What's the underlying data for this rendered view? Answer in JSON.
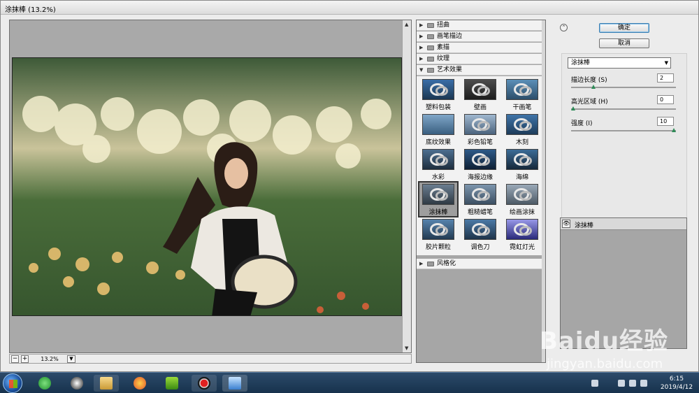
{
  "window": {
    "title": "涂抹棒 (13.2%)"
  },
  "preview": {
    "zoom": "13.2%",
    "zoom_minus": "−",
    "zoom_plus": "+"
  },
  "gallery": {
    "categories_top": [
      "扭曲",
      "画笔描边",
      "素描",
      "纹理",
      "艺术效果"
    ],
    "category_bottom": "风格化",
    "thumbnails": [
      {
        "label": "塑料包装"
      },
      {
        "label": "壁画"
      },
      {
        "label": "干画笔"
      },
      {
        "label": "底纹效果"
      },
      {
        "label": "彩色铅笔"
      },
      {
        "label": "木刻"
      },
      {
        "label": "水彩"
      },
      {
        "label": "海报边缘"
      },
      {
        "label": "海绵"
      },
      {
        "label": "涂抹棒"
      },
      {
        "label": "粗糙蜡笔"
      },
      {
        "label": "绘画涂抹"
      },
      {
        "label": "胶片颗粒"
      },
      {
        "label": "调色刀"
      },
      {
        "label": "霓虹灯光"
      }
    ],
    "selected": "涂抹棒"
  },
  "buttons": {
    "ok": "确定",
    "cancel": "取消"
  },
  "filter_select": {
    "value": "涂抹棒"
  },
  "params": [
    {
      "label": "描边长度 (S)",
      "value": "2",
      "level": 0.2
    },
    {
      "label": "高光区域 (H)",
      "value": "0",
      "level": 0.0
    },
    {
      "label": "强度 (I)",
      "value": "10",
      "level": 1.0
    }
  ],
  "layers": [
    {
      "label": "涂抹棒"
    }
  ],
  "taskbar": {
    "time": "6:15",
    "date": "2019/4/12"
  },
  "watermark": {
    "brand": "Baidu经验",
    "sub": "jingyan.baidu.com"
  },
  "colors": {
    "taskbar": "#1e3a5a",
    "accent": "#3c7fb1",
    "slider_knob": "#2e8b57"
  }
}
